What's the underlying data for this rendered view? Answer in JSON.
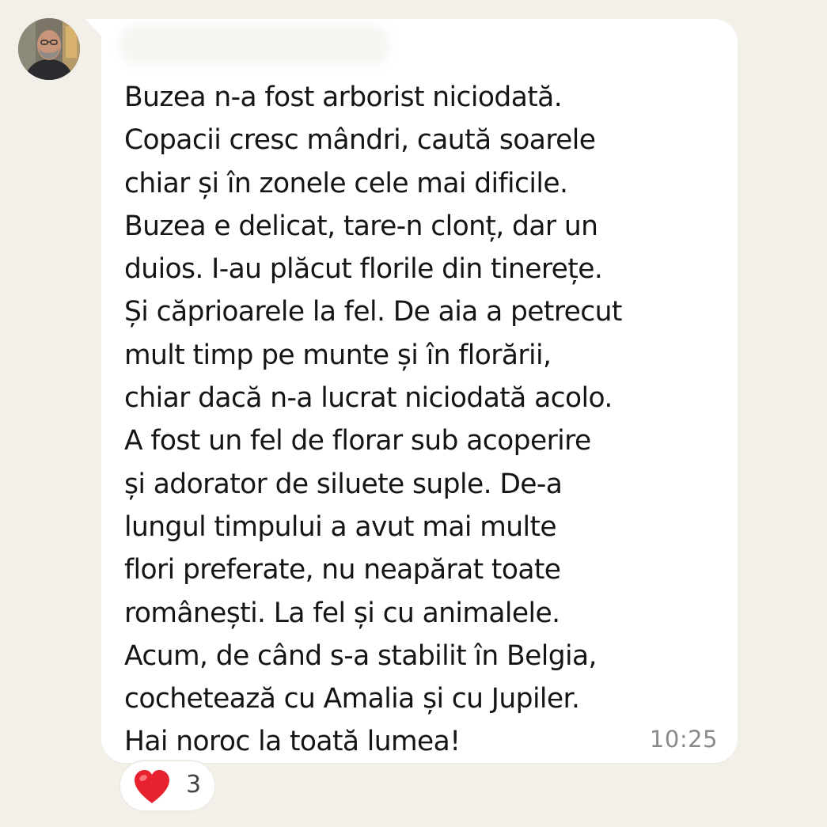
{
  "message": {
    "text": "Buzea n-a fost arborist niciodată.\nCopacii cresc mândri, caută soarele\nchiar și în zonele cele mai dificile.\nBuzea e delicat, tare-n clonț, dar un\nduios. I-au plăcut florile din tinerețe.\nȘi căprioarele la fel. De aia a petrecut\nmult timp pe munte și în florării,\nchiar dacă n-a lucrat niciodată acolo.\nA fost un fel de florar sub acoperire\nși adorator de siluete suple. De-a\nlungul timpului a avut mai multe\nflori preferate, nu neapărat toate\nromânești. La fel și cu animalele.\nAcum, de când s-a stabilit în Belgia,\ncochetează cu Amalia și cu Jupiler.\nHai noroc la toată lumea!",
    "time": "10:25"
  },
  "reaction": {
    "icon": "heart-icon",
    "count": "3"
  },
  "colors": {
    "background": "#f3f0ea",
    "bubble": "#ffffff",
    "text": "#151515",
    "timestamp": "#8a8a8a",
    "heart": "#e8212e"
  }
}
